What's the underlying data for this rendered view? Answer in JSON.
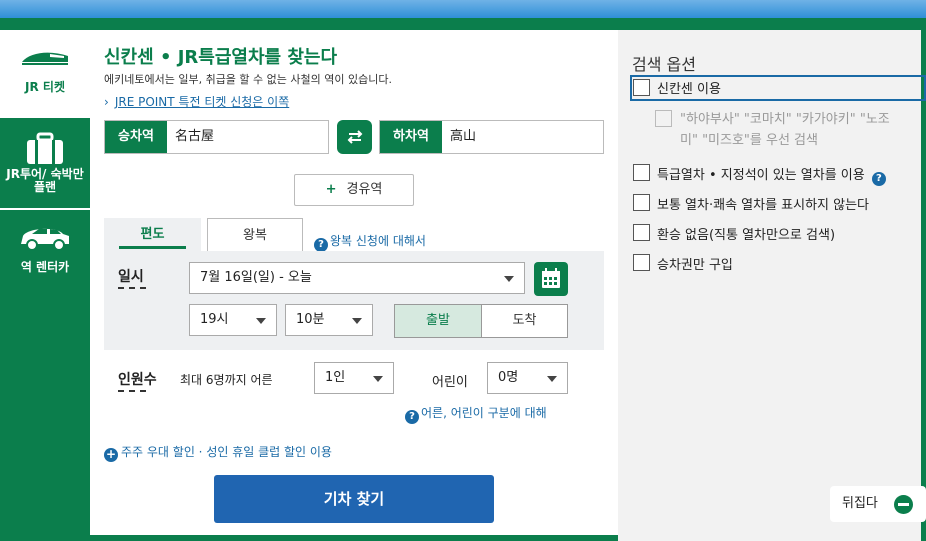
{
  "sidebar": {
    "items": [
      {
        "label": "JR 티켓",
        "icon": "shinkansen-icon"
      },
      {
        "label": "JR투어/ 숙박만 플랜",
        "icon": "suitcase-icon"
      },
      {
        "label": "역 렌터카",
        "icon": "car-icon"
      }
    ]
  },
  "header": {
    "title": "신칸센 • JR특급열차를 찾는다",
    "note": "에키네토에서는 일부, 취급을 할 수 없는 사철의 역이 있습니다.",
    "link": "JRE POINT 특전 티켓 신청은 이쪽"
  },
  "stations": {
    "from_label": "승차역",
    "from_value": "名古屋",
    "to_label": "하차역",
    "to_value": "高山",
    "swap_icon": "swap-arrows-icon",
    "via_label": "경유역"
  },
  "tabs": {
    "oneway": "편도",
    "roundtrip": "왕복",
    "help": "왕복 신청에 대해서"
  },
  "datetime": {
    "label": "일시",
    "date": "7월 16일(일) - 오늘",
    "hour": "19시",
    "minute": "10분",
    "depart": "출발",
    "arrive": "도착"
  },
  "passengers": {
    "label": "인원수",
    "max_adult": "최대 6명까지 어른",
    "adult_value": "1인",
    "child_label": "어린이",
    "child_value": "0명",
    "help": "어른, 어린이 구분에 대해"
  },
  "promo": "주주 우대 할인 · 성인 휴일 클럽 할인 이용",
  "search_button": "기차 찾기",
  "options": {
    "title": "검색 옵션",
    "items": [
      "신칸센 이용",
      "\"하야부사\" \"코마치\" \"카가야키\" \"노조",
      "미\" \"미즈호\"를 우선 검색",
      "특급열차 • 지정석이 있는 열차를 이용",
      "보통 열차·쾌속 열차를 표시하지 않는다",
      "환승 없음(직통 열차만으로 검색)",
      "승차권만 구입"
    ],
    "collapse": "뒤집다"
  },
  "colors": {
    "brand": "#0b7e4c",
    "accent": "#2065b1"
  }
}
